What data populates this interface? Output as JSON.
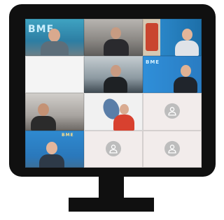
{
  "window": {
    "participants": [
      {
        "id": "p1",
        "name": "",
        "kind": "video",
        "bg": "#3d8fb0",
        "logo": "BME"
      },
      {
        "id": "p2",
        "name": "",
        "kind": "video",
        "bg": "#8c8f93"
      },
      {
        "id": "p3",
        "name": "",
        "kind": "video",
        "bg": "#1f7fb8"
      },
      {
        "id": "p4",
        "name": "",
        "kind": "blank",
        "bg": "#f4f4f4"
      },
      {
        "id": "p5",
        "name": "",
        "kind": "video",
        "bg": "#9aa7ae"
      },
      {
        "id": "p6",
        "name": "",
        "kind": "video",
        "bg": "#3b8ed6",
        "logo": "BME"
      },
      {
        "id": "p7",
        "name": "",
        "kind": "video",
        "bg": "#b9b6b3"
      },
      {
        "id": "p8",
        "name": "",
        "kind": "video",
        "bg": "#f2f2f2"
      },
      {
        "id": "p9",
        "name": "",
        "kind": "avatar",
        "bg": "#f2eceb"
      },
      {
        "id": "p10",
        "name": "",
        "kind": "video",
        "bg": "#2f86c8",
        "logo": "BME"
      },
      {
        "id": "p11",
        "name": "",
        "kind": "avatar",
        "bg": "#f2eceb"
      },
      {
        "id": "p12",
        "name": "",
        "kind": "avatar",
        "bg": "#f2eceb"
      }
    ]
  },
  "colors": {
    "monitor": "#101010",
    "avatar_circle": "#bdbdbd",
    "avatar_glyph": "#ffffff",
    "brand_blue": "#2f86c8"
  },
  "icons": {
    "avatar": "person-silhouette-icon"
  }
}
